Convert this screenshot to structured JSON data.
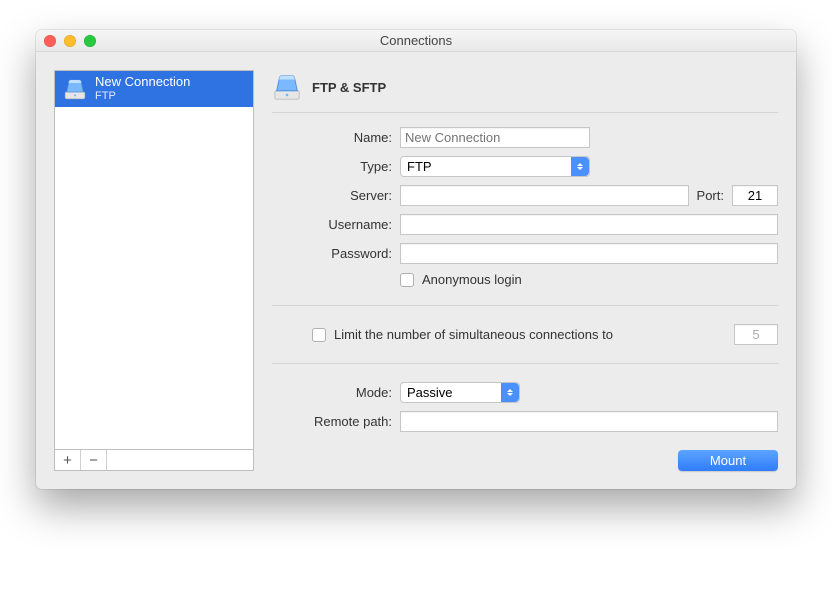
{
  "window": {
    "title": "Connections"
  },
  "sidebar": {
    "items": [
      {
        "title": "New Connection",
        "subtitle": "FTP"
      }
    ],
    "add_label": "+",
    "remove_label": "−"
  },
  "header": {
    "title": "FTP & SFTP"
  },
  "form": {
    "name_label": "Name:",
    "name_placeholder": "New Connection",
    "type_label": "Type:",
    "type_value": "FTP",
    "server_label": "Server:",
    "server_value": "",
    "port_label": "Port:",
    "port_value": "21",
    "username_label": "Username:",
    "username_value": "",
    "password_label": "Password:",
    "password_value": "",
    "anon_label": "Anonymous login",
    "limit_label": "Limit the number of simultaneous connections to",
    "limit_value": "5",
    "mode_label": "Mode:",
    "mode_value": "Passive",
    "remote_label": "Remote path:",
    "remote_value": "",
    "mount_label": "Mount"
  }
}
